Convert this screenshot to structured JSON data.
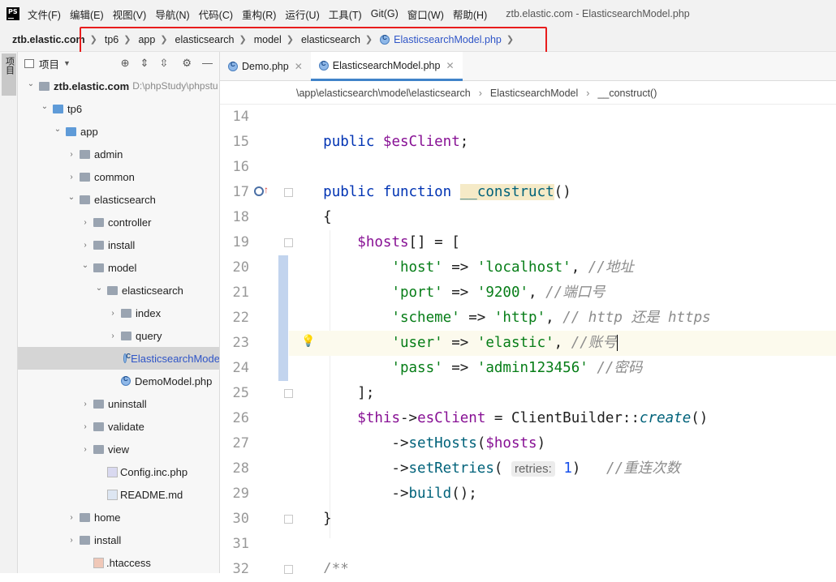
{
  "menu": {
    "items": [
      "文件(F)",
      "编辑(E)",
      "视图(V)",
      "导航(N)",
      "代码(C)",
      "重构(R)",
      "运行(U)",
      "工具(T)",
      "Git(G)",
      "窗口(W)",
      "帮助(H)"
    ],
    "window_title": "ztb.elastic.com - ElasticsearchModel.php"
  },
  "navbar": {
    "crumbs": [
      "ztb.elastic.com",
      "tp6",
      "app",
      "elasticsearch",
      "model",
      "elasticsearch",
      "ElasticsearchModel.php"
    ]
  },
  "project": {
    "tab_label": "项目",
    "header_label": "项目",
    "tree": [
      {
        "label": "ztb.elastic.com",
        "extra": "D:\\phpStudy\\phpstu",
        "type": "folder",
        "open": true,
        "level": 0,
        "bold": true
      },
      {
        "label": "tp6",
        "type": "folder-blue",
        "open": true,
        "level": 1
      },
      {
        "label": "app",
        "type": "folder-blue",
        "open": true,
        "level": 2
      },
      {
        "label": "admin",
        "type": "folder",
        "open": false,
        "level": 3
      },
      {
        "label": "common",
        "type": "folder",
        "open": false,
        "level": 3
      },
      {
        "label": "elasticsearch",
        "type": "folder",
        "open": true,
        "level": 3
      },
      {
        "label": "controller",
        "type": "folder",
        "open": false,
        "level": 4
      },
      {
        "label": "install",
        "type": "folder",
        "open": false,
        "level": 4
      },
      {
        "label": "model",
        "type": "folder",
        "open": true,
        "level": 4
      },
      {
        "label": "elasticsearch",
        "type": "folder",
        "open": true,
        "level": 5
      },
      {
        "label": "index",
        "type": "folder",
        "open": false,
        "level": 6
      },
      {
        "label": "query",
        "type": "folder",
        "open": false,
        "level": 6
      },
      {
        "label": "ElasticsearchMode",
        "type": "class",
        "level": 7,
        "selected": true
      },
      {
        "label": "DemoModel.php",
        "type": "class",
        "level": 6
      },
      {
        "label": "uninstall",
        "type": "folder",
        "open": false,
        "level": 4
      },
      {
        "label": "validate",
        "type": "folder",
        "open": false,
        "level": 4
      },
      {
        "label": "view",
        "type": "folder",
        "open": false,
        "level": 4
      },
      {
        "label": "Config.inc.php",
        "type": "php",
        "level": 5
      },
      {
        "label": "README.md",
        "type": "md",
        "level": 5
      },
      {
        "label": "home",
        "type": "folder",
        "open": false,
        "level": 3
      },
      {
        "label": "install",
        "type": "folder",
        "open": false,
        "level": 3
      },
      {
        "label": ".htaccess",
        "type": "htaccess",
        "level": 4
      }
    ]
  },
  "tabs": [
    {
      "label": "Demo.php",
      "active": false
    },
    {
      "label": "ElasticsearchModel.php",
      "active": true
    }
  ],
  "breadcrumb": [
    "\\app\\elasticsearch\\model\\elasticsearch",
    "ElasticsearchModel",
    "__construct()"
  ],
  "code": {
    "line_numbers": [
      "14",
      "15",
      "16",
      "17",
      "18",
      "19",
      "20",
      "21",
      "22",
      "23",
      "24",
      "25",
      "26",
      "27",
      "28",
      "29",
      "30",
      "31",
      "32"
    ],
    "current_line": "23"
  },
  "colors": {
    "keyword": "#0033b3",
    "variable": "#871094",
    "string": "#067d17",
    "comment": "#8c8c8c",
    "function": "#00627a",
    "highlight_border": "#e81d1d"
  }
}
